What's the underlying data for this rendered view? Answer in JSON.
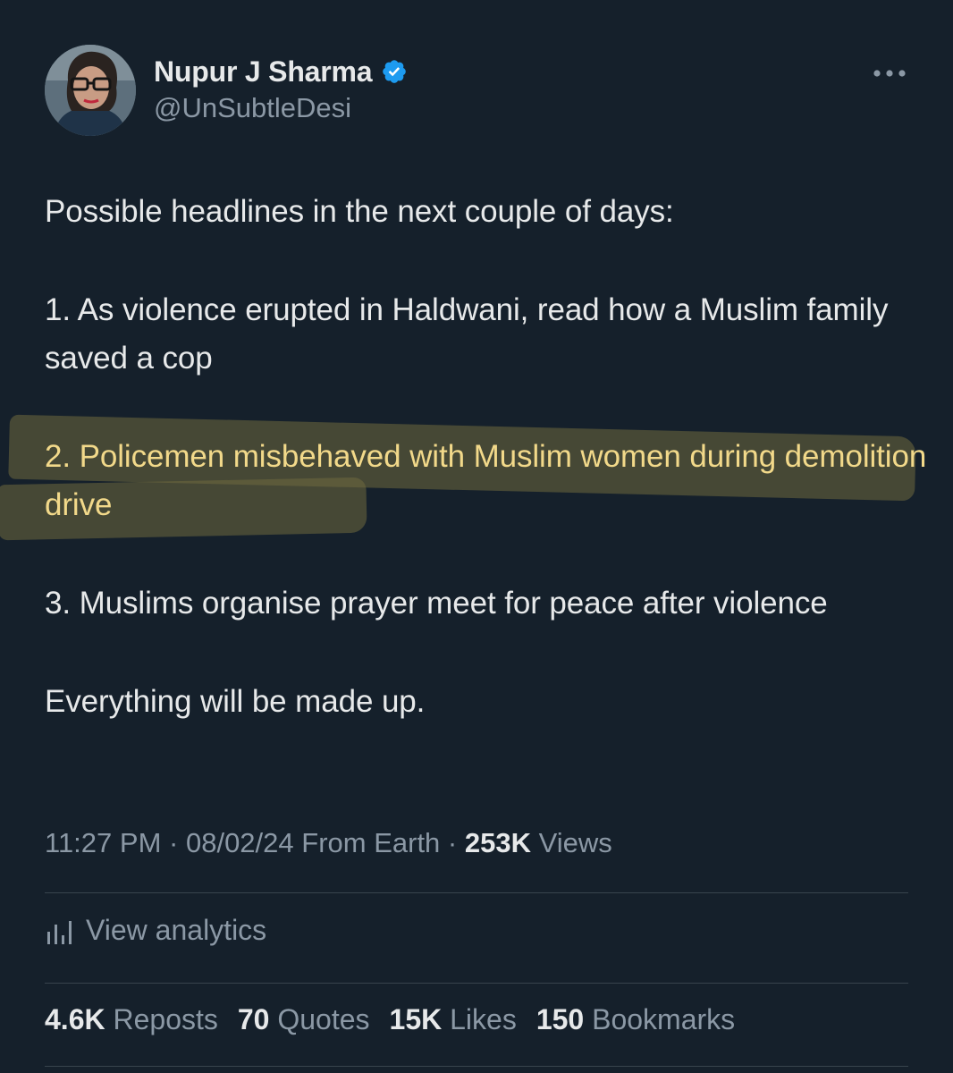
{
  "author": {
    "display_name": "Nupur J Sharma",
    "handle": "@UnSubtleDesi",
    "verified": true,
    "verified_color": "#1d9bf0"
  },
  "tweet": {
    "intro": "Possible headlines in the next couple of days:",
    "item1": "1. As violence erupted in Haldwani, read how a Muslim family saved a cop",
    "item2": "2. Policemen misbehaved with Muslim women during demolition drive",
    "item3": "3. Muslims organise prayer meet for peace after violence",
    "closing": "Everything will be made up."
  },
  "meta": {
    "time": "11:27 PM",
    "separator": "·",
    "date": "08/02/24",
    "source": "From Earth",
    "views_count": "253K",
    "views_label": "Views"
  },
  "analytics": {
    "label": "View analytics",
    "icon": "analytics-bars-icon"
  },
  "stats": {
    "reposts_count": "4.6K",
    "reposts_label": "Reposts",
    "quotes_count": "70",
    "quotes_label": "Quotes",
    "likes_count": "15K",
    "likes_label": "Likes",
    "bookmarks_count": "150",
    "bookmarks_label": "Bookmarks"
  },
  "colors": {
    "background": "#15202b",
    "text_primary": "#e7e9ea",
    "text_secondary": "#8b98a5",
    "divider": "#38444d",
    "highlight_text": "#f2d98a"
  }
}
